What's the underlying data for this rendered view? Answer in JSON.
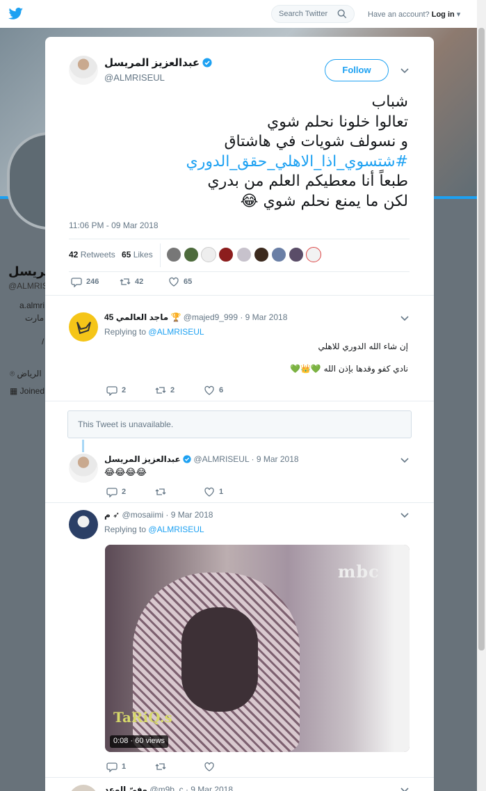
{
  "background": {
    "search_placeholder": "Search Twitter",
    "account_prompt": "Have an account?",
    "login_label": "Log in",
    "profile_name_partial": "مريسل",
    "profile_handle_partial": "@ALMRIS",
    "bio_line1": "a.almri",
    "bio_line2": "مارت",
    "bio_line3": "/",
    "location_partial": "الرياض",
    "joined_partial": "Joined"
  },
  "modal": {
    "close_label": "✕",
    "main_tweet": {
      "name": "عبدالعزيز المريسل",
      "handle": "@ALMRISEUL",
      "follow_label": "Follow",
      "text_lines": [
        "شباب",
        "تعالوا خلونا نحلم شوي",
        "و  نسولف شويات في هاشتاق",
        "#شتسوي_اذا_الاهلي_حقق_الدوري",
        "طبعاً أنا معطيكم العلم من بدري",
        "لكن ما يمنع نحلم شوي 😂"
      ],
      "timestamp": "11:06 PM - 09 Mar 2018",
      "retweets_count": "42",
      "retweets_label": "Retweets",
      "likes_count": "65",
      "likes_label": "Likes",
      "reply_count": "246",
      "retweet_count": "42",
      "like_count": "65"
    },
    "replies": [
      {
        "name": "ماجد العالمي 45 🏆",
        "handle": "@majed9_999",
        "date": "· 9 Mar 2018",
        "replying_prefix": "Replying to",
        "replying_to": "@ALMRISEUL",
        "text_line1": "إن شاء الله الدوري للاهلي",
        "text_line2": "نادي كفو وقدها بإذن الله 💚👑💚",
        "reply_count": "2",
        "retweet_count": "2",
        "like_count": "6"
      },
      {
        "unavailable_text": "This Tweet is unavailable."
      },
      {
        "name": "عبدالعزيز المريسل",
        "handle": "@ALMRISEUL",
        "date": "· 9 Mar 2018",
        "text_line1": "😂😂😂😂",
        "reply_count": "2",
        "retweet_count": "",
        "like_count": "1"
      },
      {
        "name": "م ➶",
        "handle": "@mosaiimi",
        "date": "· 9 Mar 2018",
        "replying_prefix": "Replying to",
        "replying_to": "@ALMRISEUL",
        "video_channel": "mbc",
        "video_watermark": "TaRiQ.s",
        "video_duration": "0:08",
        "video_views": "60 views",
        "reply_count": "1",
        "retweet_count": "",
        "like_count": ""
      },
      {
        "name": "وفيّ الوعد",
        "handle": "@m9b_c",
        "date": "· 9 Mar 2018"
      }
    ]
  },
  "colors": {
    "accent": "#1da1f2",
    "secondary_text": "#657786",
    "border": "#e6ecf0"
  },
  "icons": [
    "twitter-bird-icon",
    "search-icon",
    "verified-badge-icon",
    "chevron-down-icon",
    "reply-icon",
    "retweet-icon",
    "like-icon",
    "close-icon"
  ]
}
